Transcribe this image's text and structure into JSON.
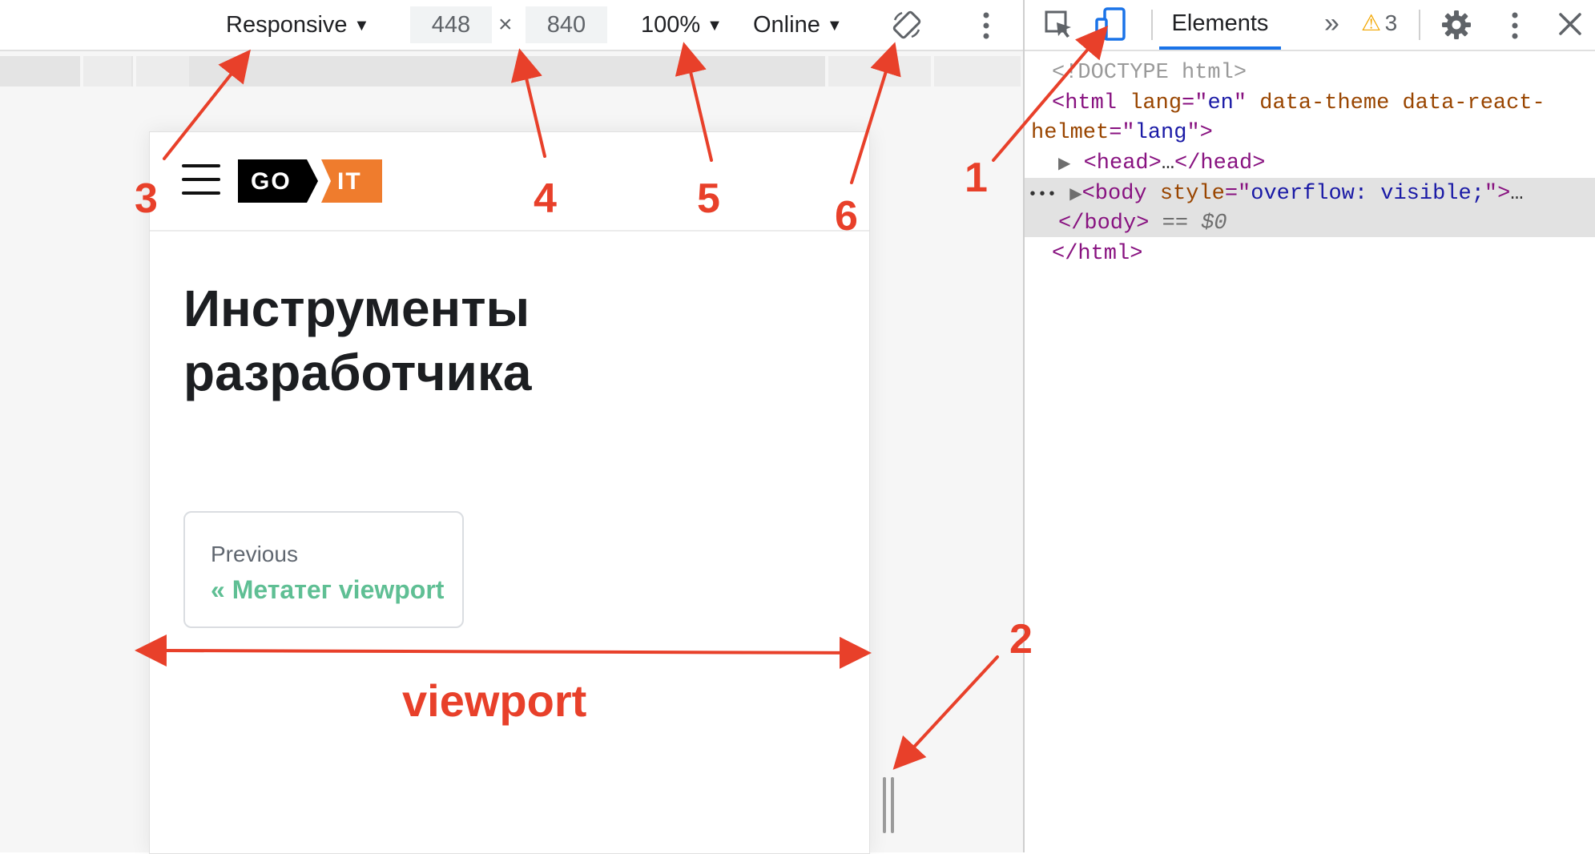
{
  "device_toolbar": {
    "device_label": "Responsive",
    "width_value": "448",
    "times_sign": "×",
    "height_value": "840",
    "zoom_label": "100%",
    "throttle_label": "Online",
    "caret": "▼"
  },
  "page": {
    "logo_left": "GO",
    "logo_right": "IT",
    "title": "Инструменты разработчика",
    "prev_sub": "Previous",
    "prev_link": "« Метатег viewport"
  },
  "devtools": {
    "tab_elements": "Elements",
    "more_tabs": "»",
    "warnings_count": "3",
    "warning_symbol": "⚠",
    "dom": {
      "doctype": "<!DOCTYPE html>",
      "html_open_tag": "<html",
      "html_attr1": "lang",
      "html_val1": "en",
      "html_attr2": "data-theme data-react-",
      "html_attr2b": "helmet",
      "html_val2": "lang",
      "head_open": "<head>",
      "ellipsis": "…",
      "head_close": "</head>",
      "row_dots": "•••",
      "body_open": "<body",
      "body_attr": "style",
      "body_val": "overflow: visible;",
      "body_close": "</body>",
      "selected_marker": "== $0",
      "html_close": "</html>"
    }
  },
  "annotations": {
    "n1": "1",
    "n2": "2",
    "n3": "3",
    "n4": "4",
    "n5": "5",
    "n6": "6",
    "viewport_label": "viewport",
    "arrow_color": "#e8402a"
  },
  "colors": {
    "accent_blue": "#1a73e8",
    "logo_orange": "#ef7c2d",
    "link_green": "#5fbf94",
    "annotation_red": "#e8402a"
  }
}
